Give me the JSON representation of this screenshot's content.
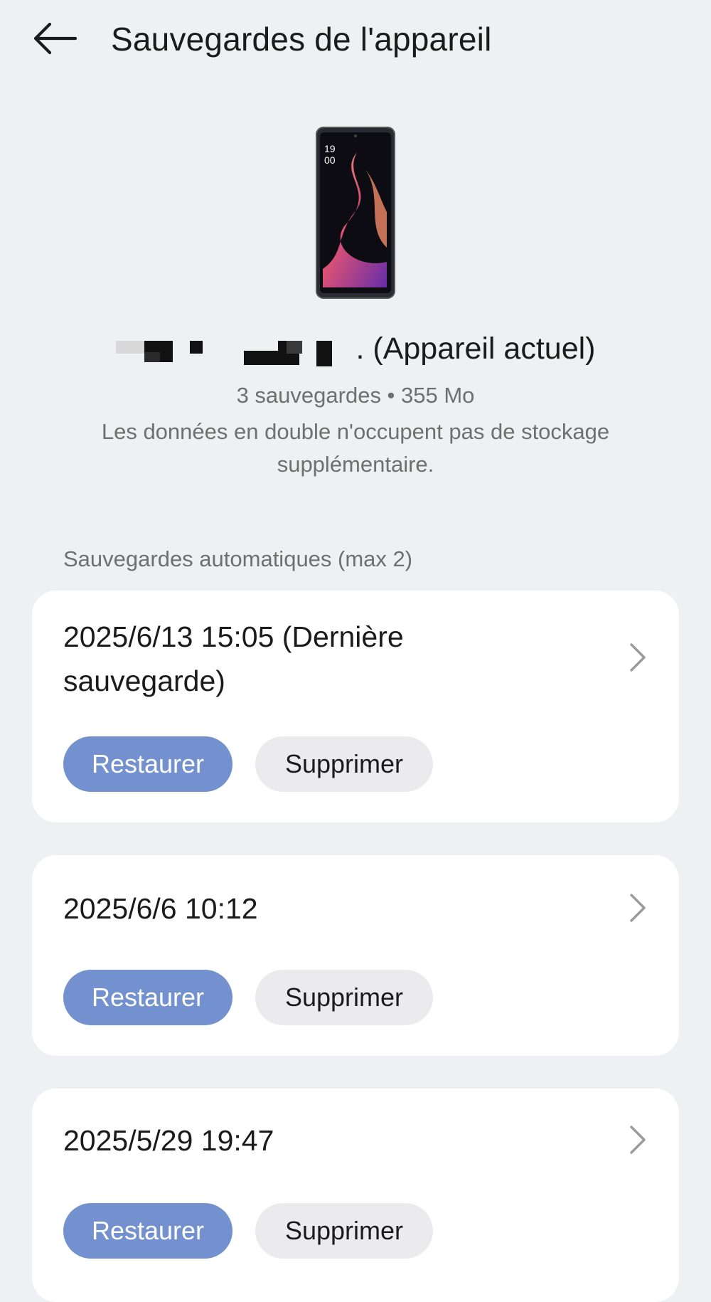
{
  "header": {
    "title": "Sauvegardes de l'appareil",
    "back_icon": "arrow-left-icon"
  },
  "device": {
    "image_icon": "phone-device-image",
    "name_suffix": ". (Appareil actuel)",
    "backup_summary": "3 sauvegardes • 355 Mo",
    "duplicate_note": "Les données en double n'occupent pas de stockage supplémentaire."
  },
  "auto_backups": {
    "section_title": "Sauvegardes automatiques (max 2)",
    "items": [
      {
        "title": "2025/6/13 15:05 (Dernière sauvegarde)",
        "restore_label": "Restaurer",
        "delete_label": "Supprimer"
      },
      {
        "title": "2025/6/6 10:12",
        "restore_label": "Restaurer",
        "delete_label": "Supprimer"
      },
      {
        "title": "2025/5/29 19:47",
        "restore_label": "Restaurer",
        "delete_label": "Supprimer"
      }
    ]
  },
  "colors": {
    "background": "#eff0f3",
    "card": "#ffffff",
    "restore_button": "#7391cf",
    "delete_button": "#ebebed",
    "secondary_text": "#6f6f6f"
  }
}
